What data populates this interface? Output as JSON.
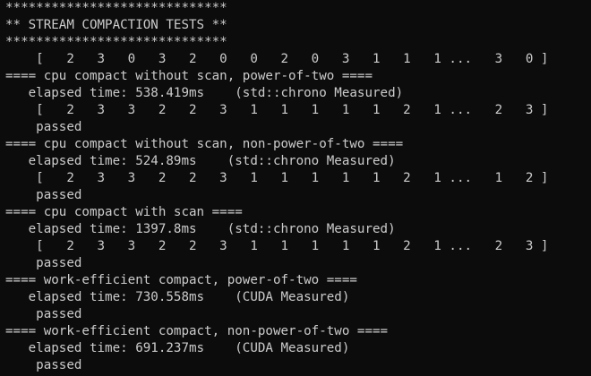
{
  "colors": {
    "background": "#0c0c0c",
    "foreground": "#cccccc"
  },
  "terminal": {
    "lines": [
      "*****************************",
      "** STREAM COMPACTION TESTS **",
      "*****************************",
      "    [   2   3   0   3   2   0   0   2   0   3   1   1   1 ...   3   0 ]",
      "==== cpu compact without scan, power-of-two ====",
      "   elapsed time: 538.419ms    (std::chrono Measured)",
      "    [   2   3   3   2   2   3   1   1   1   1   1   2   1 ...   2   3 ]",
      "    passed",
      "==== cpu compact without scan, non-power-of-two ====",
      "   elapsed time: 524.89ms    (std::chrono Measured)",
      "    [   2   3   3   2   2   3   1   1   1   1   1   2   1 ...   1   2 ]",
      "    passed",
      "==== cpu compact with scan ====",
      "   elapsed time: 1397.8ms    (std::chrono Measured)",
      "    [   2   3   3   2   2   3   1   1   1   1   1   2   1 ...   2   3 ]",
      "    passed",
      "==== work-efficient compact, power-of-two ====",
      "   elapsed time: 730.558ms    (CUDA Measured)",
      "    passed",
      "==== work-efficient compact, non-power-of-two ====",
      "   elapsed time: 691.237ms    (CUDA Measured)",
      "    passed"
    ]
  }
}
